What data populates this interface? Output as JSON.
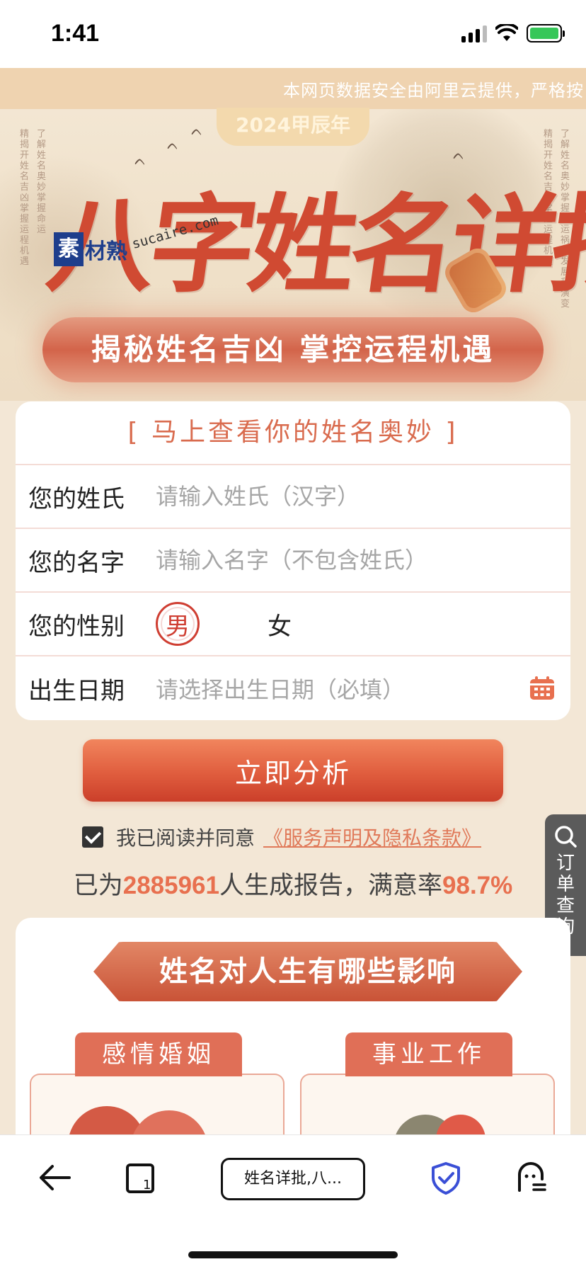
{
  "status_bar": {
    "time": "1:41"
  },
  "hero": {
    "notice": "本网页数据安全由阿里云提供，严格按",
    "year_badge": "2024甲辰年",
    "title": "八字姓名详批",
    "subtitle": "揭秘姓名吉凶 掌控运程机遇",
    "side_text_left_1": "精揭开姓名吉凶 掌握运程机遇",
    "side_text_left_2": "了解姓名奥妙掌握命运",
    "side_text_right_1": "精揭开姓名吉凶 掌握运程机遇",
    "side_text_right_2": "了解姓名奥妙掌握命运祸福发展和演变",
    "watermark_brand_box": "素",
    "watermark_brand_rest": "材熟",
    "watermark_url": "sucaire.com"
  },
  "form": {
    "heading": "[ 马上查看你的姓名奥妙 ]",
    "surname_label": "您的姓氏",
    "surname_placeholder": "请输入姓氏（汉字）",
    "surname_value": "",
    "name_label": "您的名字",
    "name_placeholder": "请输入名字（不包含姓氏）",
    "name_value": "",
    "gender_label": "您的性别",
    "gender_male": "男",
    "gender_female": "女",
    "gender_selected": "男",
    "birth_label": "出生日期",
    "birth_placeholder": "请选择出生日期（必填）"
  },
  "analyze_button": "立即分析",
  "agreement": {
    "checked": true,
    "text": "我已阅读并同意",
    "link": "《服务声明及隐私条款》"
  },
  "stats": {
    "prefix": "已为",
    "count": "2885961",
    "middle": "人生成报告，满意率",
    "rate": "98.7%"
  },
  "side_query": {
    "label": "订单查询"
  },
  "influence": {
    "title": "姓名对人生有哪些影响",
    "categories": [
      "感情婚姻",
      "事业工作"
    ]
  },
  "browser": {
    "tab_title": "姓名详批,八..."
  },
  "colors": {
    "accent": "#d96b4e",
    "button": "#e05d3e",
    "stats_number": "#e8704f",
    "shield": "#3a4fd6"
  }
}
